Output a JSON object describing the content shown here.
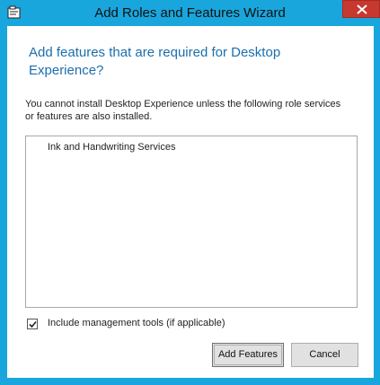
{
  "window": {
    "title": "Add Roles and Features Wizard",
    "icon": "wizard-app-icon",
    "close_icon": "close-icon"
  },
  "dialog": {
    "heading": "Add features that are required for Desktop Experience?",
    "message": "You cannot install Desktop Experience unless the following role services or features are also installed.",
    "required_items": [
      {
        "label": "Ink and Handwriting Services"
      }
    ],
    "include_tools": {
      "label": "Include management tools (if applicable)",
      "checked": true
    },
    "buttons": {
      "add_features": "Add Features",
      "cancel": "Cancel"
    }
  },
  "colors": {
    "frame": "#19a6dc",
    "heading": "#1a6fae",
    "close": "#c7392f"
  }
}
